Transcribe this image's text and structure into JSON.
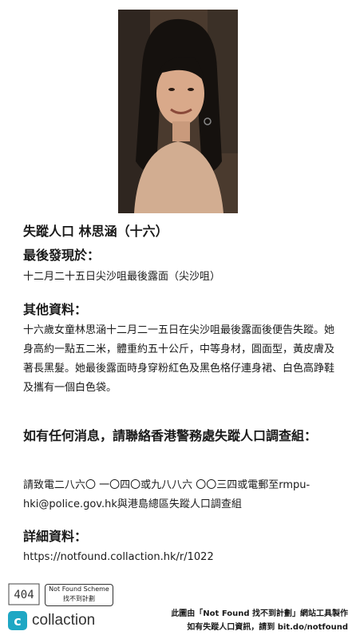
{
  "person_title": "失蹤人口 林思涵（十六）",
  "last_seen": {
    "heading": "最後發現於：",
    "text": "十二月二十五日尖沙咀最後露面（尖沙咀）"
  },
  "other_info": {
    "heading": "其他資料：",
    "text": "十六歲女童林思涵十二月二一五日在尖沙咀最後露面後便告失蹤。她身高約一點五二米，體重約五十公斤，中等身材，圓面型，黃皮膚及著長黑髮。她最後露面時身穿粉紅色及黑色格仔連身裙、白色高踭鞋及攜有一個白色袋。"
  },
  "contact": {
    "heading": "如有任何消息，請聯絡香港警務處失蹤人口調查組：",
    "text": "請致電二八六〇 一〇四〇或九八八六 〇〇三四或電郵至rmpu-hki@police.gov.hk與港島總區失蹤人口調查組"
  },
  "details": {
    "heading": "詳細資料：",
    "url": "https://notfound.collaction.hk/r/1022"
  },
  "footer": {
    "logo_404": "404",
    "scheme_en": "Not Found Scheme",
    "scheme_zh": "找不到計劃",
    "brand_icon": "c",
    "brand": "collaction",
    "credit_line1": "此圖由「Not Found 找不到計劃」網站工具製作",
    "credit_line2": "如有失蹤人口資訊，請到 bit.do/notfound"
  },
  "colors": {
    "brand": "#1fa7c4"
  }
}
